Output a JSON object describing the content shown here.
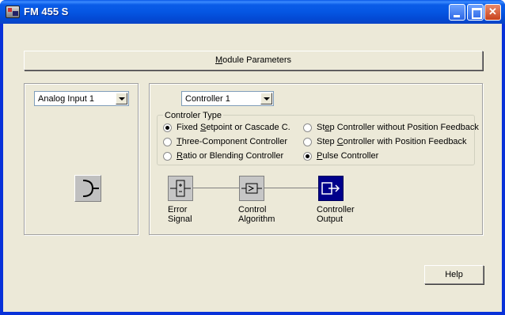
{
  "window": {
    "title": "FM 455 S",
    "controls": {
      "minimize": "minimize-icon",
      "maximize": "maximize-icon",
      "close": "close-icon"
    }
  },
  "module_parameters": {
    "label_pre": "",
    "label_u": "M",
    "label_post": "odule Parameters"
  },
  "left_panel": {
    "selected_input": "Analog Input 1",
    "icon": "analog-input-symbol-icon"
  },
  "right_panel": {
    "selected_controller": "Controller 1",
    "controller_type": {
      "title": "Controler Type",
      "options": [
        {
          "pre": "Fixed ",
          "u": "S",
          "post": "etpoint or Cascade C.",
          "selected": true
        },
        {
          "pre": "",
          "u": "T",
          "post": "hree-Component Controller",
          "selected": false
        },
        {
          "pre": "",
          "u": "R",
          "post": "atio or Blending Controller",
          "selected": false
        },
        {
          "pre": "St",
          "u": "e",
          "post": "p Controller without Position Feedback",
          "selected": false
        },
        {
          "pre": "Step ",
          "u": "C",
          "post": "ontroller with Position Feedback",
          "selected": false
        },
        {
          "pre": "",
          "u": "P",
          "post": "ulse Controller",
          "selected": true
        }
      ]
    },
    "signal_chain": [
      {
        "label": "Error\nSignal",
        "icon": "error-signal-icon",
        "style": "grey"
      },
      {
        "label": "Control\nAlgorithm",
        "icon": "control-algorithm-icon",
        "style": "grey"
      },
      {
        "label": "Controller\nOutput",
        "icon": "controller-output-icon",
        "style": "blue"
      }
    ]
  },
  "help_button": {
    "label": "Help"
  },
  "colors": {
    "title_bar": "#0556e3",
    "face": "#ece9d8",
    "output_block": "#00008b"
  }
}
